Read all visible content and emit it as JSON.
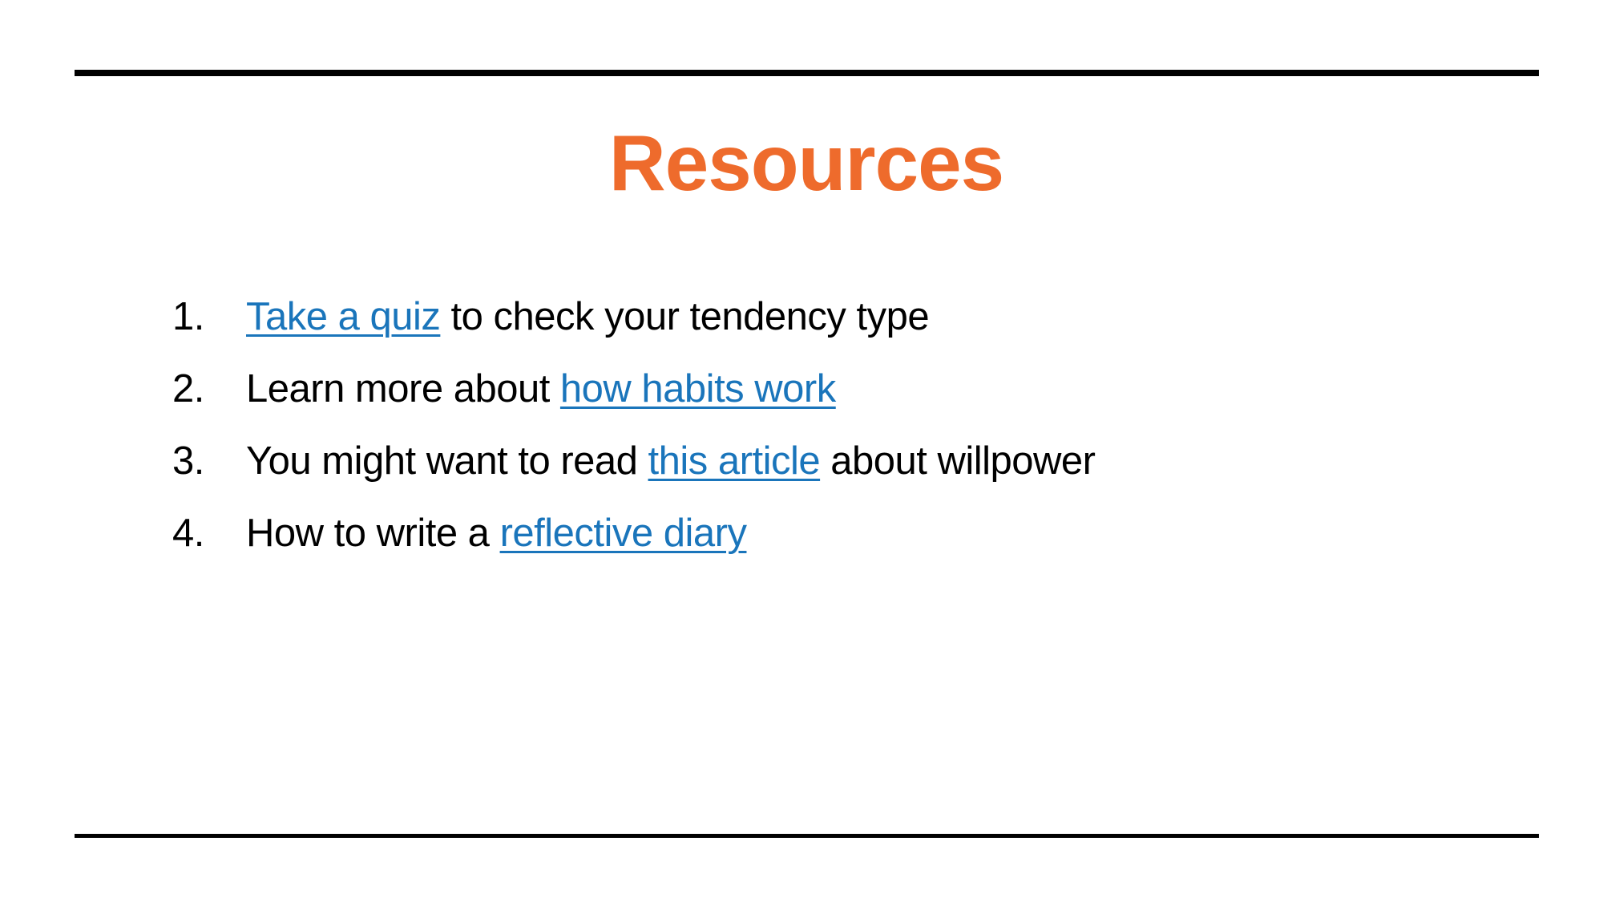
{
  "slide": {
    "title": "Resources",
    "items": [
      {
        "number": "1.",
        "before": "",
        "link": "Take a quiz",
        "after": " to check your tendency type"
      },
      {
        "number": "2.",
        "before": "Learn more about ",
        "link": "how habits work",
        "after": ""
      },
      {
        "number": "3.",
        "before": "You might want to read ",
        "link": "this article",
        "after": " about willpower"
      },
      {
        "number": "4.",
        "before": "How to write a ",
        "link": "reflective diary",
        "after": ""
      }
    ]
  },
  "colors": {
    "title": "#ee6b2c",
    "link": "#1a75bb",
    "text": "#000000",
    "rule": "#000000",
    "background": "#ffffff"
  }
}
